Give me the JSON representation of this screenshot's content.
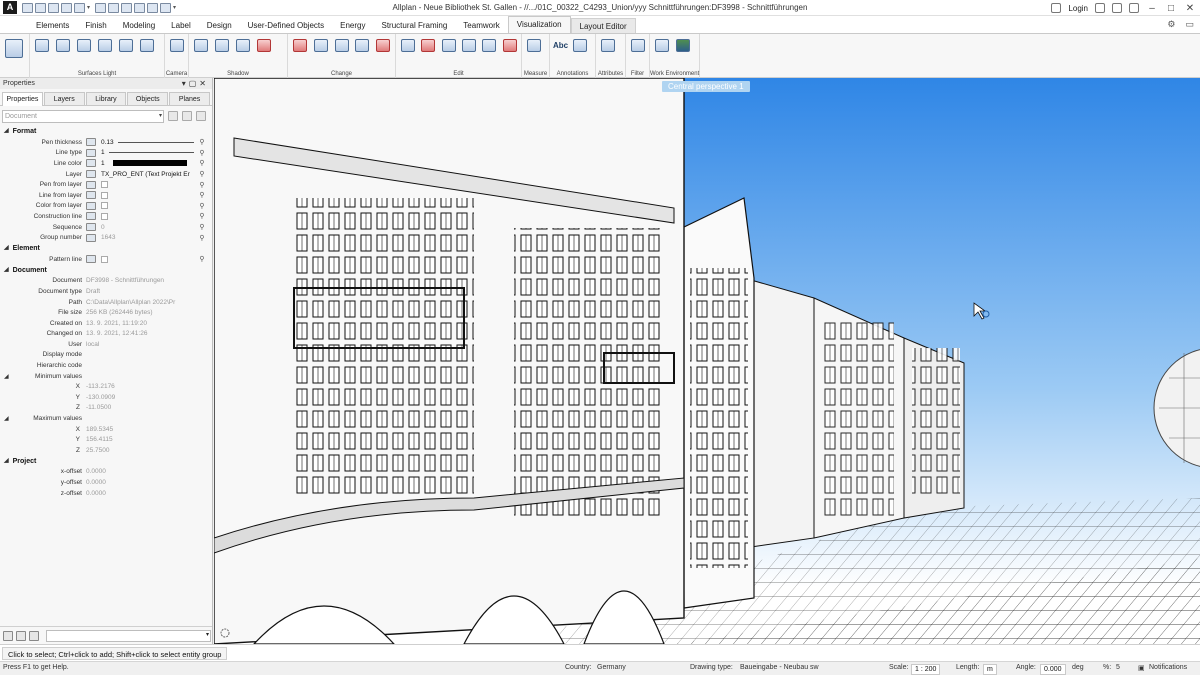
{
  "window": {
    "title": "Allplan - Neue Bibliothek St. Gallen - //.../01C_00322_C4293_Union/yyy Schnittführungen:DF3998 - Schnittführungen",
    "login": "Login",
    "logo": "A"
  },
  "menu_tabs": [
    "Elements",
    "Finish",
    "Modeling",
    "Label",
    "Design",
    "User-Defined Objects",
    "Energy",
    "Structural Framing",
    "Teamwork",
    "Visualization",
    "Layout Editor"
  ],
  "active_tab": "Visualization",
  "ribbon_groups": [
    {
      "label": "Surfaces Light"
    },
    {
      "label": "Camera"
    },
    {
      "label": "Shadow"
    },
    {
      "label": "Change"
    },
    {
      "label": "Edit"
    },
    {
      "label": "Measure"
    },
    {
      "label": "Annotations",
      "abc": "Abc"
    },
    {
      "label": "Attributes"
    },
    {
      "label": "Filter"
    },
    {
      "label": "Work Environment"
    }
  ],
  "panel": {
    "title": "Properties",
    "tabs": [
      "Properties",
      "Layers",
      "Library",
      "Objects",
      "Planes"
    ],
    "doc_select": "Document",
    "format": {
      "title": "Format",
      "pen_thickness_label": "Pen thickness",
      "pen_thickness": "0.13",
      "line_type_label": "Line type",
      "line_type": "1",
      "line_color_label": "Line color",
      "line_color": "1",
      "layer_label": "Layer",
      "layer": "TX_PRO_ENT (Text Projekt Er",
      "pen_from_layer": "Pen from layer",
      "line_from_layer": "Line from layer",
      "color_from_layer": "Color from layer",
      "construction_line": "Construction line",
      "sequence_label": "Sequence",
      "sequence": "0",
      "group_number_label": "Group number",
      "group_number": "1643"
    },
    "element": {
      "title": "Element",
      "pattern_line": "Pattern line"
    },
    "document": {
      "title": "Document",
      "document_label": "Document",
      "document": "DF3998 - Schnittführungen",
      "doc_type_label": "Document type",
      "doc_type": "Draft",
      "path_label": "Path",
      "path": "C:\\Data\\Allplan\\Allplan 2022\\Pr",
      "file_size_label": "File size",
      "file_size": "256 KB (262446 bytes)",
      "created_label": "Created on",
      "created": "13. 9. 2021, 11:19:20",
      "changed_label": "Changed on",
      "changed": "13. 9. 2021, 12:41:26",
      "user_label": "User",
      "user": "local",
      "display_mode_label": "Display mode",
      "hier_code_label": "Hierarchic code",
      "min_label": "Minimum values",
      "min_x": "-113.2176",
      "min_y": "-130.0909",
      "min_z": "-11.0500",
      "max_label": "Maximum values",
      "max_x": "189.5345",
      "max_y": "156.4115",
      "max_z": "25.7500",
      "x": "X",
      "y": "Y",
      "z": "Z"
    },
    "project": {
      "title": "Project",
      "x_offset_label": "x-offset",
      "x_offset": "0.0000",
      "y_offset_label": "y-offset",
      "y_offset": "0.0000",
      "z_offset_label": "z-offset",
      "z_offset": "0.0000"
    }
  },
  "viewport": {
    "label": "Central perspective 1"
  },
  "command_bar": "Click to select; Ctrl+click to add; Shift+click to select entity group",
  "status": {
    "help": "Press F1 to get Help.",
    "country_label": "Country:",
    "country": "Germany",
    "drawing_type_label": "Drawing type:",
    "drawing_type": "Baueingabe - Neubau sw",
    "scale_label": "Scale:",
    "scale": "1 : 200",
    "length_label": "Length:",
    "length": "m",
    "angle_label": "Angle:",
    "angle": "0.000",
    "angle_unit": "deg",
    "percent_label": "%:",
    "percent": "5",
    "notifications": "Notifications"
  },
  "colors": {
    "sky_top": "#2f86e6",
    "sky_bottom": "#ffffff",
    "accent": "#1f5fa8"
  }
}
